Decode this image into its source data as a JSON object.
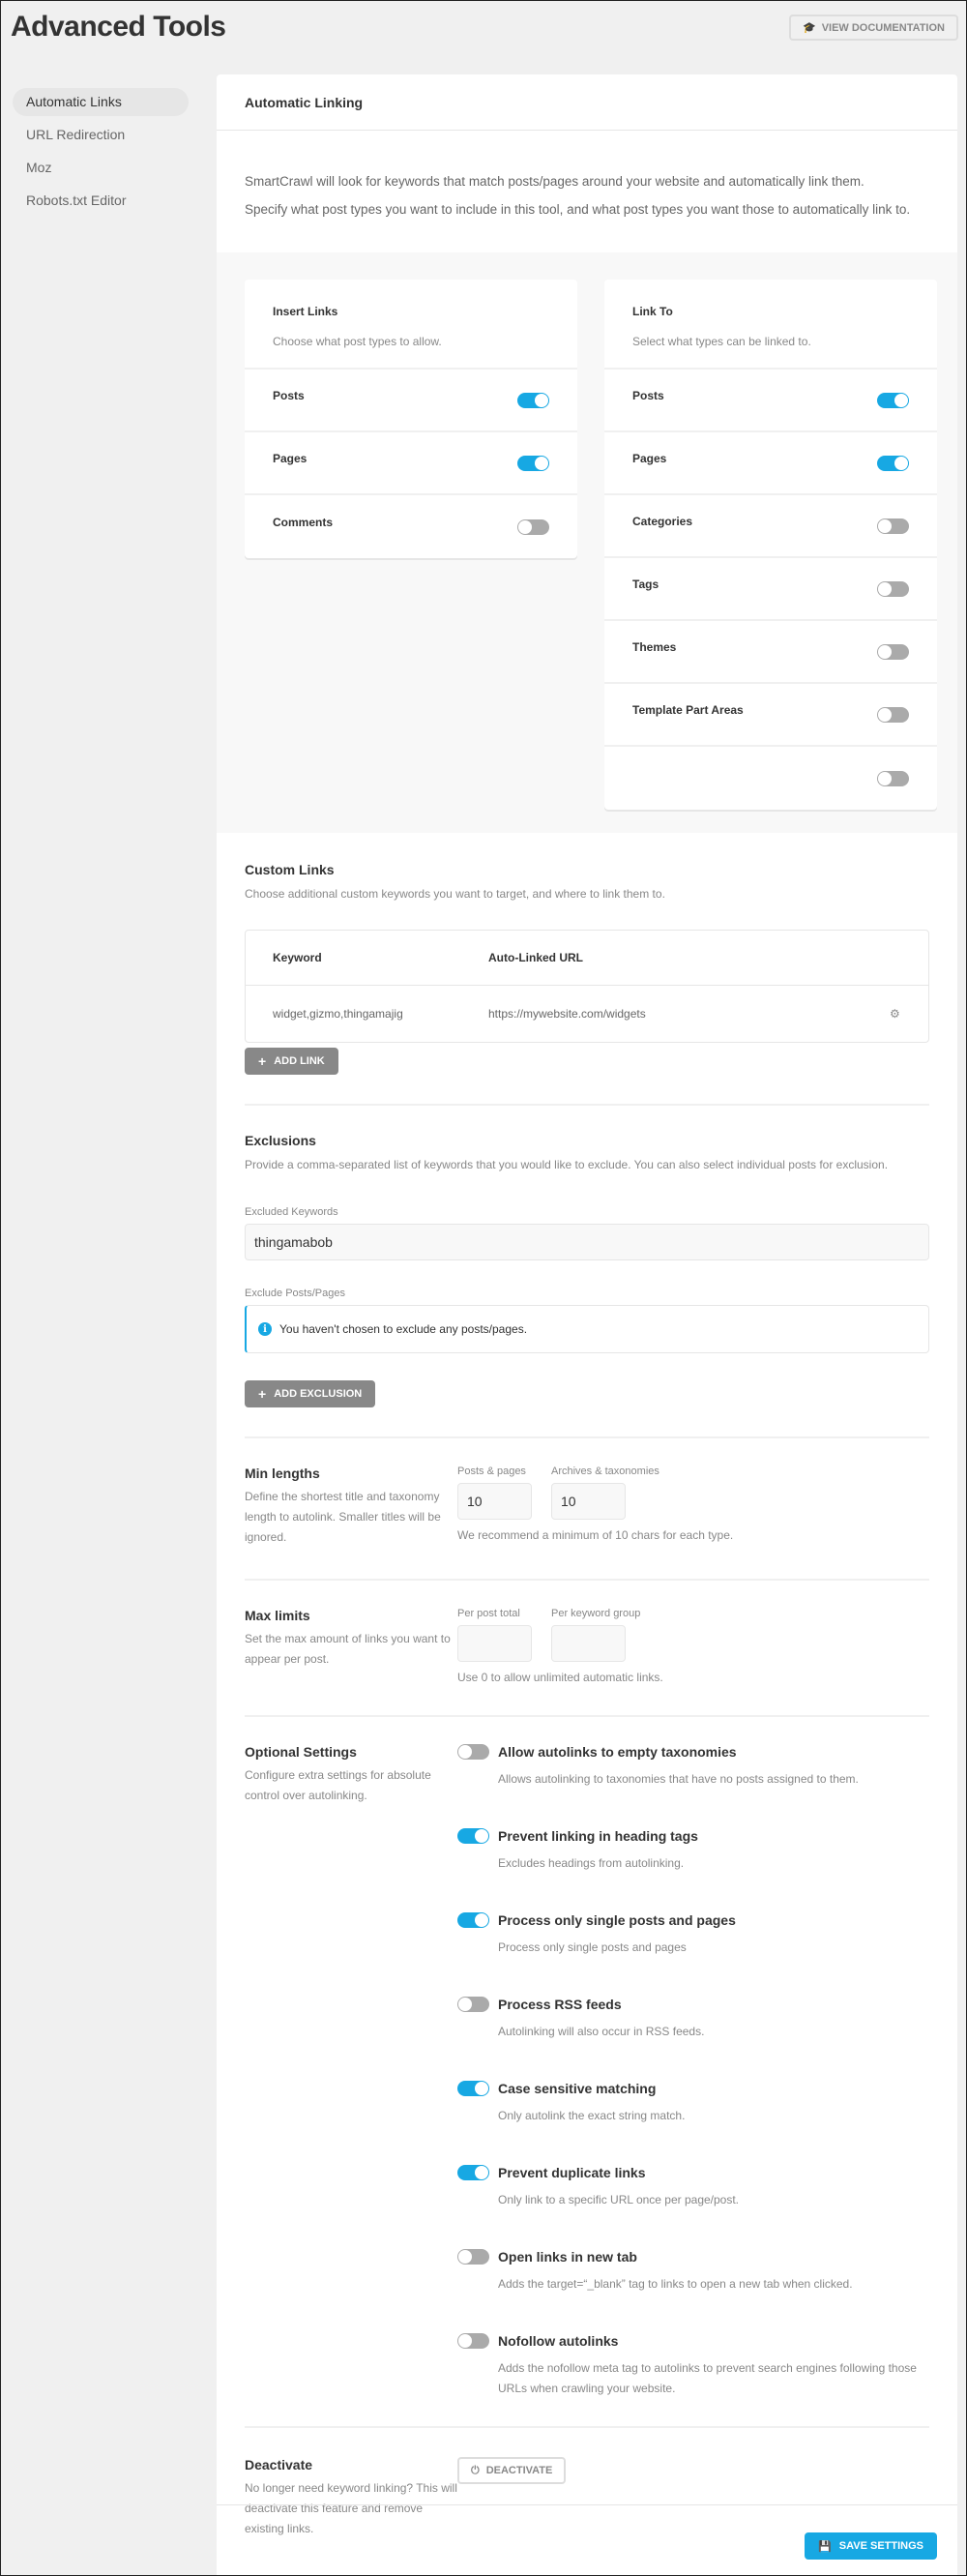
{
  "page": {
    "title": "Advanced Tools",
    "doc_button": "VIEW DOCUMENTATION",
    "doc_icon": "graduation-cap-icon"
  },
  "sidebar": {
    "items": [
      {
        "label": "Automatic Links",
        "active": true
      },
      {
        "label": "URL Redirection",
        "active": false
      },
      {
        "label": "Moz",
        "active": false
      },
      {
        "label": "Robots.txt Editor",
        "active": false
      }
    ]
  },
  "main": {
    "header": "Automatic Linking",
    "intro": [
      "SmartCrawl will look for keywords that match posts/pages around your website and automatically link them.",
      "Specify what post types you want to include in this tool, and what post types you want those to automatically link to."
    ]
  },
  "insert_links": {
    "title": "Insert Links",
    "desc": "Choose what post types to allow.",
    "items": [
      {
        "label": "Posts",
        "on": true
      },
      {
        "label": "Pages",
        "on": true
      },
      {
        "label": "Comments",
        "on": false
      }
    ]
  },
  "link_to": {
    "title": "Link To",
    "desc": "Select what types can be linked to.",
    "items": [
      {
        "label": "Posts",
        "on": true
      },
      {
        "label": "Pages",
        "on": true
      },
      {
        "label": "Categories",
        "on": false
      },
      {
        "label": "Tags",
        "on": false
      },
      {
        "label": "Themes",
        "on": false
      },
      {
        "label": "Template Part Areas",
        "on": false
      },
      {
        "label": "",
        "on": false
      }
    ]
  },
  "custom_links": {
    "title": "Custom Links",
    "desc": "Choose additional custom keywords you want to target, and where to link them to.",
    "columns": [
      "Keyword",
      "Auto-Linked URL"
    ],
    "rows": [
      {
        "keyword": "widget,gizmo,thingamajig",
        "url": "https://mywebsite.com/widgets"
      }
    ],
    "add_button": "ADD LINK"
  },
  "exclusions": {
    "title": "Exclusions",
    "desc": "Provide a comma-separated list of keywords that you would like to exclude. You can also select individual posts for exclusion.",
    "keywords_label": "Excluded Keywords",
    "keywords_value": "thingamabob",
    "posts_label": "Exclude Posts/Pages",
    "notice": "You haven't chosen to exclude any posts/pages.",
    "add_button": "ADD EXCLUSION"
  },
  "min_lengths": {
    "title": "Min lengths",
    "desc": "Define the shortest title and taxonomy length to autolink. Smaller titles will be ignored.",
    "fields": [
      {
        "label": "Posts & pages",
        "value": "10"
      },
      {
        "label": "Archives & taxonomies",
        "value": "10"
      }
    ],
    "hint": "We recommend a minimum of 10 chars for each type."
  },
  "max_limits": {
    "title": "Max limits",
    "desc": "Set the max amount of links you want to appear per post.",
    "fields": [
      {
        "label": "Per post total",
        "value": ""
      },
      {
        "label": "Per keyword group",
        "value": ""
      }
    ],
    "hint": "Use 0 to allow unlimited automatic links."
  },
  "optional": {
    "title": "Optional Settings",
    "desc": "Configure extra settings for absolute control over autolinking.",
    "items": [
      {
        "title": "Allow autolinks to empty taxonomies",
        "desc": "Allows autolinking to taxonomies that have no posts assigned to them.",
        "on": false
      },
      {
        "title": "Prevent linking in heading tags",
        "desc": "Excludes headings from autolinking.",
        "on": true
      },
      {
        "title": "Process only single posts and pages",
        "desc": "Process only single posts and pages",
        "on": true
      },
      {
        "title": "Process RSS feeds",
        "desc": "Autolinking will also occur in RSS feeds.",
        "on": false
      },
      {
        "title": "Case sensitive matching",
        "desc": "Only autolink the exact string match.",
        "on": true
      },
      {
        "title": "Prevent duplicate links",
        "desc": "Only link to a specific URL once per page/post.",
        "on": true
      },
      {
        "title": "Open links in new tab",
        "desc": "Adds the target=“_blank” tag to links to open a new tab when clicked.",
        "on": false
      },
      {
        "title": "Nofollow autolinks",
        "desc": "Adds the nofollow meta tag to autolinks to prevent search engines following those URLs when crawling your website.",
        "on": false
      }
    ]
  },
  "deactivate": {
    "title": "Deactivate",
    "desc": "No longer need keyword linking? This will deactivate this feature and remove existing links.",
    "button": "DEACTIVATE"
  },
  "footer": {
    "save_button": "SAVE SETTINGS"
  },
  "colors": {
    "accent": "#17a8e3",
    "toggle_off": "#aaaaaa",
    "gray_button": "#888888"
  }
}
